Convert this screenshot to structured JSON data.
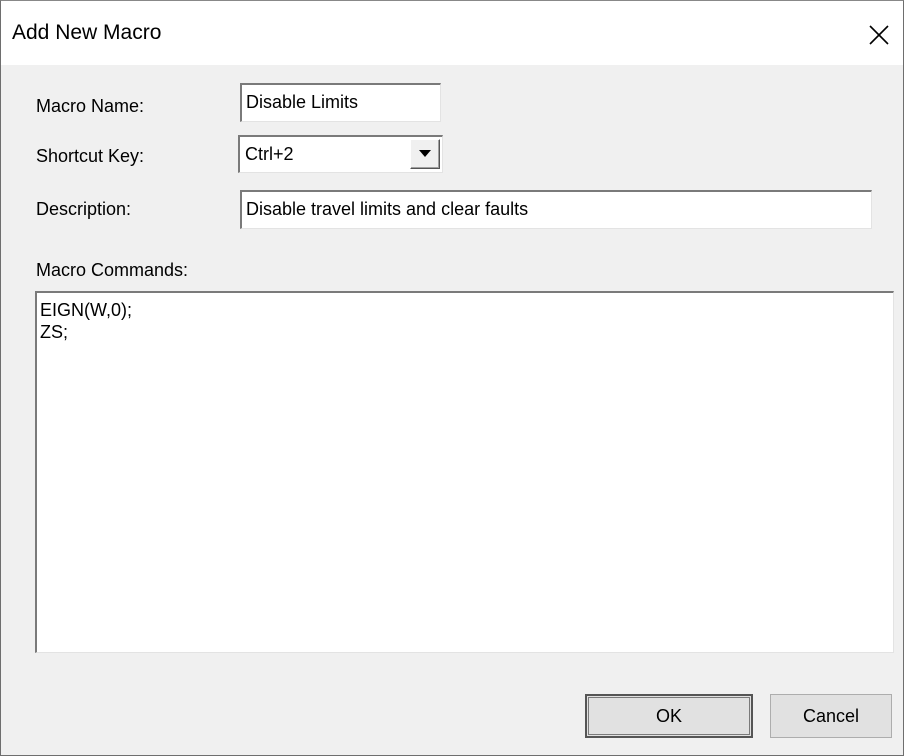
{
  "window": {
    "title": "Add New Macro",
    "close_icon": "close-icon"
  },
  "form": {
    "macro_name_label": "Macro Name:",
    "macro_name_value": "Disable Limits",
    "shortcut_key_label": "Shortcut Key:",
    "shortcut_key_value": "Ctrl+2",
    "shortcut_key_dropdown_icon": "chevron-down-icon",
    "description_label": "Description:",
    "description_value": "Disable travel limits and clear faults",
    "macro_commands_label": "Macro Commands:",
    "macro_commands_lines": [
      "EIGN(W,0);",
      "ZS;"
    ]
  },
  "buttons": {
    "ok_label": "OK",
    "cancel_label": "Cancel"
  },
  "colors": {
    "dialog_background": "#f0f0f0",
    "titlebar_background": "#ffffff",
    "field_background": "#ffffff",
    "button_face": "#e1e1e1"
  }
}
